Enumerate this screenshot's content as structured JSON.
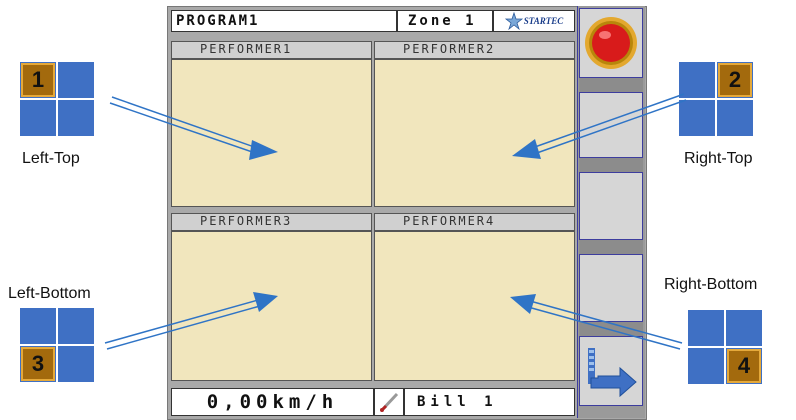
{
  "header": {
    "program": "PROGRAM1",
    "zone": "Zone 1",
    "logo_text": "STARTEC"
  },
  "panels": [
    {
      "label": "PERFORMER1"
    },
    {
      "label": "PERFORMER2"
    },
    {
      "label": "PERFORMER3"
    },
    {
      "label": "PERFORMER4"
    }
  ],
  "footer": {
    "speed": "0,00km/h",
    "operator": "Bill 1"
  },
  "corners": {
    "left_top": {
      "number": "1",
      "label": "Left-Top"
    },
    "right_top": {
      "number": "2",
      "label": "Right-Top"
    },
    "left_bottom": {
      "number": "3",
      "label": "Left-Bottom"
    },
    "right_bottom": {
      "number": "4",
      "label": "Right-Bottom"
    }
  },
  "colors": {
    "panel_body": "#f1e6bd",
    "tile_blue": "#3f70c4",
    "tile_number_bg": "#a36a0d",
    "arrow_blue": "#2f74c6",
    "stop_red": "#d81b1b"
  },
  "icons": {
    "emergency_stop": "emergency-stop-icon",
    "exit": "exit-arrow-icon",
    "pen": "pen-icon",
    "logo": "startec-logo"
  }
}
